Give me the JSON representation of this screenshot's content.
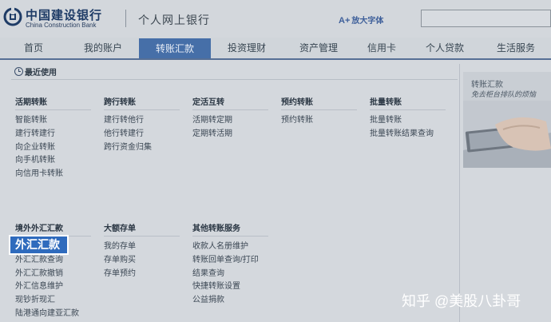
{
  "header": {
    "bank_name": "中国建设银行",
    "bank_name_en": "China Construction Bank",
    "site_name": "个人网上银行",
    "font_size_label": "放大字体"
  },
  "nav": {
    "items": [
      {
        "label": "首页"
      },
      {
        "label": "我的账户"
      },
      {
        "label": "转账汇款"
      },
      {
        "label": "投资理财"
      },
      {
        "label": "资产管理"
      },
      {
        "label": "信用卡"
      },
      {
        "label": "个人贷款"
      },
      {
        "label": "生活服务"
      }
    ],
    "active_index": 2
  },
  "menu": {
    "recent_label": "最近使用",
    "columns_top": [
      {
        "title": "活期转账",
        "links": [
          "智能转账",
          "建行转建行",
          "向企业转账",
          "向手机转账",
          "向信用卡转账"
        ]
      },
      {
        "title": "跨行转账",
        "links": [
          "建行转他行",
          "他行转建行",
          "跨行资金归集"
        ]
      },
      {
        "title": "定活互转",
        "links": [
          "活期转定期",
          "定期转活期"
        ]
      },
      {
        "title": "预约转账",
        "links": [
          "预约转账"
        ]
      },
      {
        "title": "批量转账",
        "links": [
          "批量转账",
          "批量转账结果查询"
        ]
      }
    ],
    "columns_bottom": [
      {
        "title": "境外外汇汇款",
        "highlight": "外汇汇款",
        "links": [
          "外汇汇款查询",
          "外汇汇款撤销",
          "外汇信息维护",
          "现钞折现汇",
          "陆港通向建亚汇款"
        ]
      },
      {
        "title": "大额存单",
        "links": [
          "我的存单",
          "存单购买",
          "存单预约"
        ]
      },
      {
        "title": "其他转账服务",
        "links": [
          "收款人名册维护",
          "转账回单查询/打印",
          "结果查询",
          "快捷转账设置",
          "公益捐款"
        ]
      }
    ]
  },
  "ad": {
    "title": "转账汇款",
    "subtitle": "免去柜台排队的烦恼"
  },
  "watermark": "知乎 @美股八卦哥",
  "colors": {
    "nav_active": "#466fa8",
    "highlight": "#2f6bbd",
    "brand": "#1e3b66"
  }
}
